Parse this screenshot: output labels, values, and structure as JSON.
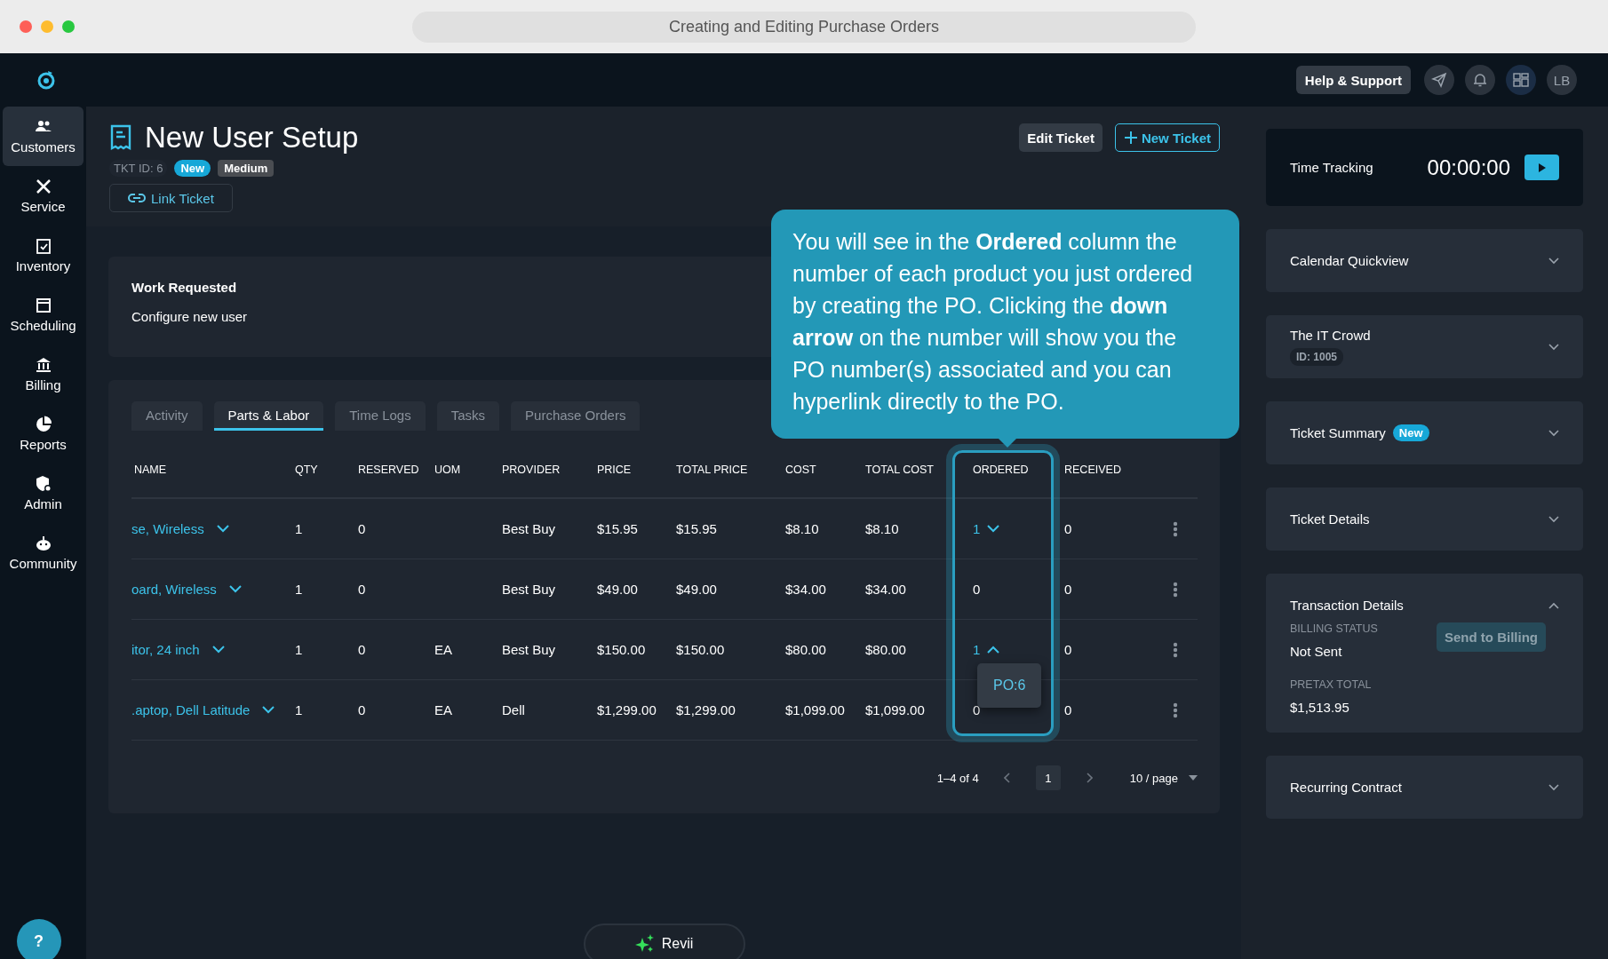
{
  "browser": {
    "title": "Creating and Editing Purchase Orders"
  },
  "app_header": {
    "help_button": "Help & Support",
    "avatar": "LB"
  },
  "sidebar": {
    "items": [
      {
        "label": "Customers",
        "selected": true
      },
      {
        "label": "Service",
        "selected": false
      },
      {
        "label": "Inventory",
        "selected": false
      },
      {
        "label": "Scheduling",
        "selected": false
      },
      {
        "label": "Billing",
        "selected": false
      },
      {
        "label": "Reports",
        "selected": false
      },
      {
        "label": "Admin",
        "selected": false
      },
      {
        "label": "Community",
        "selected": false
      }
    ],
    "help": "?"
  },
  "ticket": {
    "title": "New User Setup",
    "id": "TKT ID: 6",
    "status": "New",
    "priority": "Medium",
    "link_button": "Link Ticket",
    "edit_button": "Edit Ticket",
    "new_button": "New Ticket"
  },
  "work_requested": {
    "heading": "Work Requested",
    "text": "Configure new user"
  },
  "tabs": [
    {
      "label": "Activity",
      "selected": false
    },
    {
      "label": "Parts & Labor",
      "selected": true
    },
    {
      "label": "Time Logs",
      "selected": false
    },
    {
      "label": "Tasks",
      "selected": false
    },
    {
      "label": "Purchase Orders",
      "selected": false
    }
  ],
  "table": {
    "columns": [
      "NAME",
      "QTY",
      "RESERVED",
      "UOM",
      "PROVIDER",
      "PRICE",
      "TOTAL PRICE",
      "COST",
      "TOTAL COST",
      "ORDERED",
      "RECEIVED"
    ],
    "rows": [
      {
        "name": "se, Wireless",
        "qty": "1",
        "reserved": "0",
        "provider": "Best Buy",
        "price": "$15.95",
        "total_price": "$15.95",
        "cost": "$8.10",
        "total_cost": "$8.10",
        "ordered": {
          "value": "1",
          "has_po": true,
          "expanded": false
        },
        "received": "0"
      },
      {
        "name": "oard, Wireless",
        "qty": "1",
        "reserved": "0",
        "provider": "Best Buy",
        "price": "$49.00",
        "total_price": "$49.00",
        "cost": "$34.00",
        "total_cost": "$34.00",
        "ordered": {
          "value": "0",
          "has_po": false
        },
        "received": "0"
      },
      {
        "name": "itor, 24 inch",
        "qty": "1",
        "reserved": "0",
        "uom": "EA",
        "provider": "Best Buy",
        "price": "$150.00",
        "total_price": "$150.00",
        "cost": "$80.00",
        "total_cost": "$80.00",
        "ordered": {
          "value": "1",
          "has_po": true,
          "expanded": true,
          "po_links": [
            "PO:6"
          ]
        },
        "received": "0"
      },
      {
        "name": ".aptop, Dell Latitude",
        "qty": "1",
        "reserved": "0",
        "uom": "EA",
        "provider": "Dell",
        "price": "$1,299.00",
        "total_price": "$1,299.00",
        "cost": "$1,099.00",
        "total_cost": "$1,099.00",
        "ordered": {
          "value": "0",
          "has_po": false
        },
        "received": "0"
      }
    ]
  },
  "pagination": {
    "range": "1–4 of 4",
    "pages": [
      {
        "label": "1",
        "selected": true
      }
    ],
    "page_size": "10 / page"
  },
  "tooltip": {
    "text": "You will see in the **Ordered** column the number of each product you just ordered by creating the PO. Clicking the **down arrow** on the number will show you the PO number(s) associated and you can hyperlink directly to the PO."
  },
  "time_tracking": {
    "label": "Time Tracking",
    "time": "00:00:00"
  },
  "panels": [
    {
      "title": "Calendar Quickview",
      "expanded": false
    },
    {
      "title": "The IT Crowd",
      "id_tag": "ID: 1005",
      "expanded": false
    },
    {
      "title": "Ticket Summary",
      "badge": "New",
      "expanded": false
    },
    {
      "title": "Ticket Details",
      "expanded": false
    },
    {
      "title": "Transaction Details",
      "expanded": true,
      "fields": [
        {
          "label": "BILLING STATUS",
          "value": "Not Sent"
        },
        {
          "label": "PRETAX TOTAL",
          "value": "$1,513.95"
        }
      ],
      "button": {
        "label": "Send to Billing",
        "disabled": true
      }
    },
    {
      "title": "Recurring Contract",
      "expanded": false
    }
  ],
  "assistant_button": "Revii"
}
